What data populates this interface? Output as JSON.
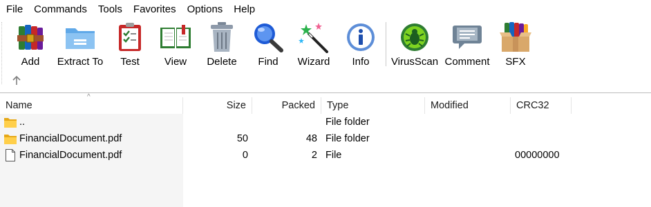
{
  "menu": [
    "File",
    "Commands",
    "Tools",
    "Favorites",
    "Options",
    "Help"
  ],
  "toolbar": {
    "buttons": [
      {
        "label": "Add",
        "icon": "add-archive-icon"
      },
      {
        "label": "Extract To",
        "icon": "extract-folder-icon"
      },
      {
        "label": "Test",
        "icon": "test-clipboard-icon"
      },
      {
        "label": "View",
        "icon": "view-book-icon"
      },
      {
        "label": "Delete",
        "icon": "trash-can-icon"
      },
      {
        "label": "Find",
        "icon": "magnifier-icon"
      },
      {
        "label": "Wizard",
        "icon": "magic-wand-icon"
      },
      {
        "label": "Info",
        "icon": "info-icon"
      },
      {
        "label": "VirusScan",
        "icon": "virus-bug-icon"
      },
      {
        "label": "Comment",
        "icon": "comment-bubble-icon"
      },
      {
        "label": "SFX",
        "icon": "sfx-box-icon"
      }
    ],
    "up_icon": "up-arrow-icon"
  },
  "columns": {
    "name": "Name",
    "size": "Size",
    "packed": "Packed",
    "type": "Type",
    "modified": "Modified",
    "crc": "CRC32"
  },
  "rows": [
    {
      "icon": "folder-icon",
      "name": "..",
      "size": "",
      "packed": "",
      "type": "File folder",
      "modified": "",
      "crc": ""
    },
    {
      "icon": "folder-icon",
      "name": "FinancialDocument.pdf",
      "size": "50",
      "packed": "48",
      "type": "File folder",
      "modified": "",
      "crc": ""
    },
    {
      "icon": "file-icon",
      "name": "FinancialDocument.pdf",
      "size": "0",
      "packed": "2",
      "type": "File",
      "modified": "",
      "crc": "00000000"
    }
  ]
}
